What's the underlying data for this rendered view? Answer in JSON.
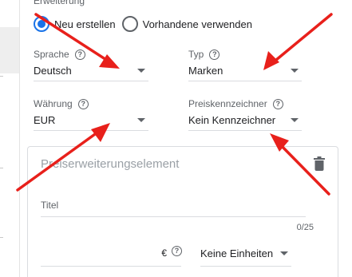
{
  "section": {
    "label": "Erweiterung"
  },
  "mode": {
    "options": [
      {
        "label": "Neu erstellen",
        "checked": true
      },
      {
        "label": "Vorhandene verwenden",
        "checked": false
      }
    ]
  },
  "fields": {
    "sprache": {
      "label": "Sprache",
      "value": "Deutsch"
    },
    "typ": {
      "label": "Typ",
      "value": "Marken"
    },
    "waehrung": {
      "label": "Währung",
      "value": "EUR"
    },
    "preiskennzeichner": {
      "label": "Preiskennzeichner",
      "value": "Kein Kennzeichner"
    }
  },
  "card": {
    "title": "Preiserweiterungselement",
    "title_field": {
      "placeholder": "Titel",
      "counter": "0/25"
    },
    "price": {
      "currency_symbol": "€"
    },
    "unit": {
      "value": "Keine Einheiten"
    }
  },
  "icons": {
    "help": "help-circle-icon",
    "trash": "delete-icon",
    "dropdown": "dropdown-caret-icon"
  },
  "colors": {
    "accent": "#1a73e8",
    "annotation": "#e8201b",
    "muted_text": "#5f6368"
  }
}
